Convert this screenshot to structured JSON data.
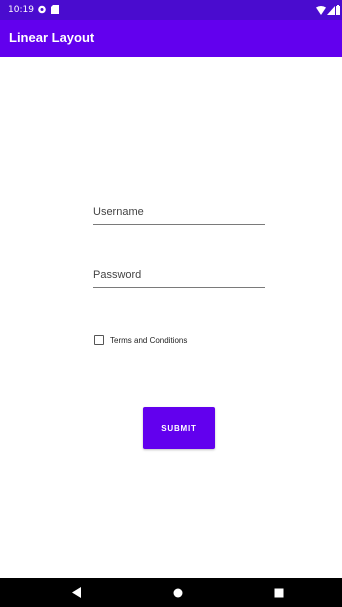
{
  "status_bar": {
    "time": "10:19",
    "icons": [
      "notification-app-icon",
      "sd-card-icon",
      "wifi-icon",
      "signal-icon",
      "battery-icon"
    ]
  },
  "app_bar": {
    "title": "Linear Layout",
    "color": "#6200ee",
    "status_color": "#4a0ccf"
  },
  "form": {
    "username_placeholder": "Username",
    "username_value": "",
    "password_placeholder": "Password",
    "password_value": "",
    "terms_label": "Terms and Conditions",
    "terms_checked": false,
    "submit_label": "SUBMIT",
    "accent_color": "#6200ee"
  },
  "nav_bar": {
    "buttons": [
      "back-icon",
      "home-icon",
      "recents-icon"
    ]
  }
}
